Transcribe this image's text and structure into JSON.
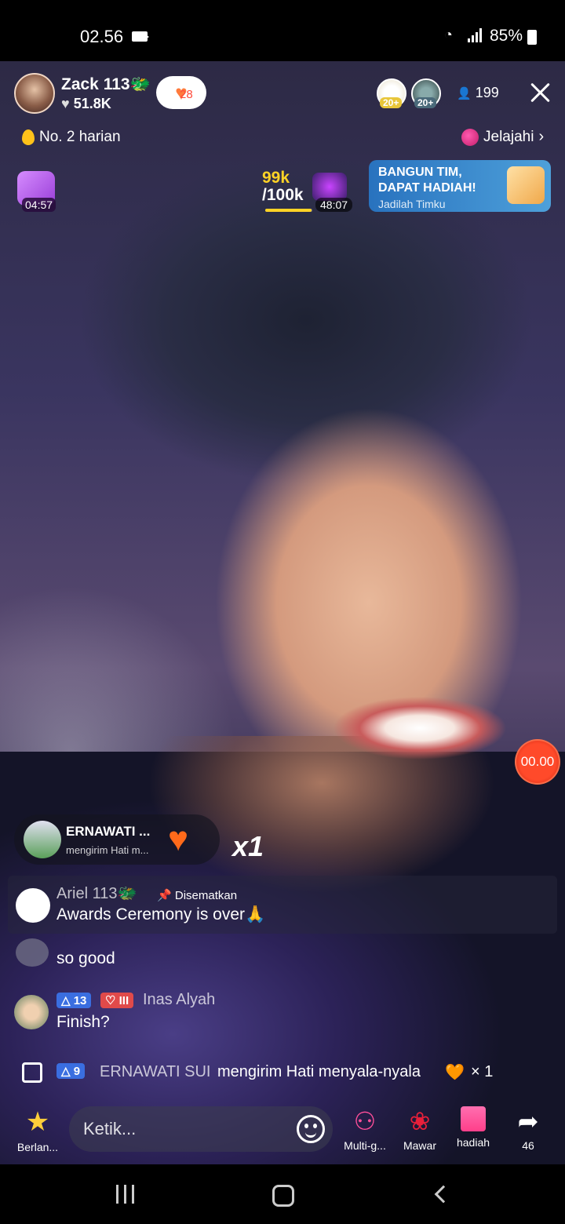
{
  "status_bar": {
    "time": "02.56",
    "battery": "85%"
  },
  "host": {
    "name": "Zack 113🐲",
    "likes": "51.8K",
    "follow_count": "28"
  },
  "viewers": {
    "top1_badge": "20+",
    "top2_badge": "20+",
    "count": "199"
  },
  "rank": {
    "label": "No. 2 harian"
  },
  "explore": {
    "label": "Jelajahi"
  },
  "timer": {
    "value": "04:57"
  },
  "goal": {
    "current": "99k",
    "target": "/100k",
    "progress": 0.99,
    "time": "48:07"
  },
  "team_banner": {
    "title_line1": "BANGUN TIM,",
    "title_line2": "DAPAT HADIAH!",
    "subtitle": "Jadilah Timku"
  },
  "record": {
    "value": "00.00"
  },
  "gift_notification": {
    "name": "ERNAWATI ...",
    "action": "mengirim Hati m...",
    "multiplier": "x1"
  },
  "comments": [
    {
      "name": "Ariel 113🐲",
      "pin_label": "Disematkan",
      "text": "Awards Ceremony is over🙏"
    },
    {
      "name": "",
      "text": "so good"
    },
    {
      "name": "Inas Alyah",
      "level": "13",
      "fan_level": "III",
      "text": "Finish?"
    }
  ],
  "gift_system": {
    "level": "9",
    "name": "ERNAWATI SUI",
    "action": "mengirim Hati menyala-nyala",
    "heart": "🧡",
    "count": "× 1"
  },
  "bottom": {
    "explore_label": "Berlan...",
    "input_placeholder": "Ketik...",
    "multi_label": "Multi-g...",
    "rose_label": "Mawar",
    "gift_label": "hadiah",
    "share_count": "46"
  },
  "colors": {
    "accent_yellow": "#ffd326",
    "accent_red": "#ff4a2a",
    "banner_blue": "#3a8ad0"
  },
  "icons": [
    "camera-icon",
    "wifi-icon",
    "signal-icon",
    "battery-icon",
    "heart-icon",
    "close-icon",
    "fire-icon",
    "explore-icon",
    "gift-icon",
    "emoji-icon",
    "multi-guest-icon",
    "rose-icon",
    "share-icon"
  ]
}
